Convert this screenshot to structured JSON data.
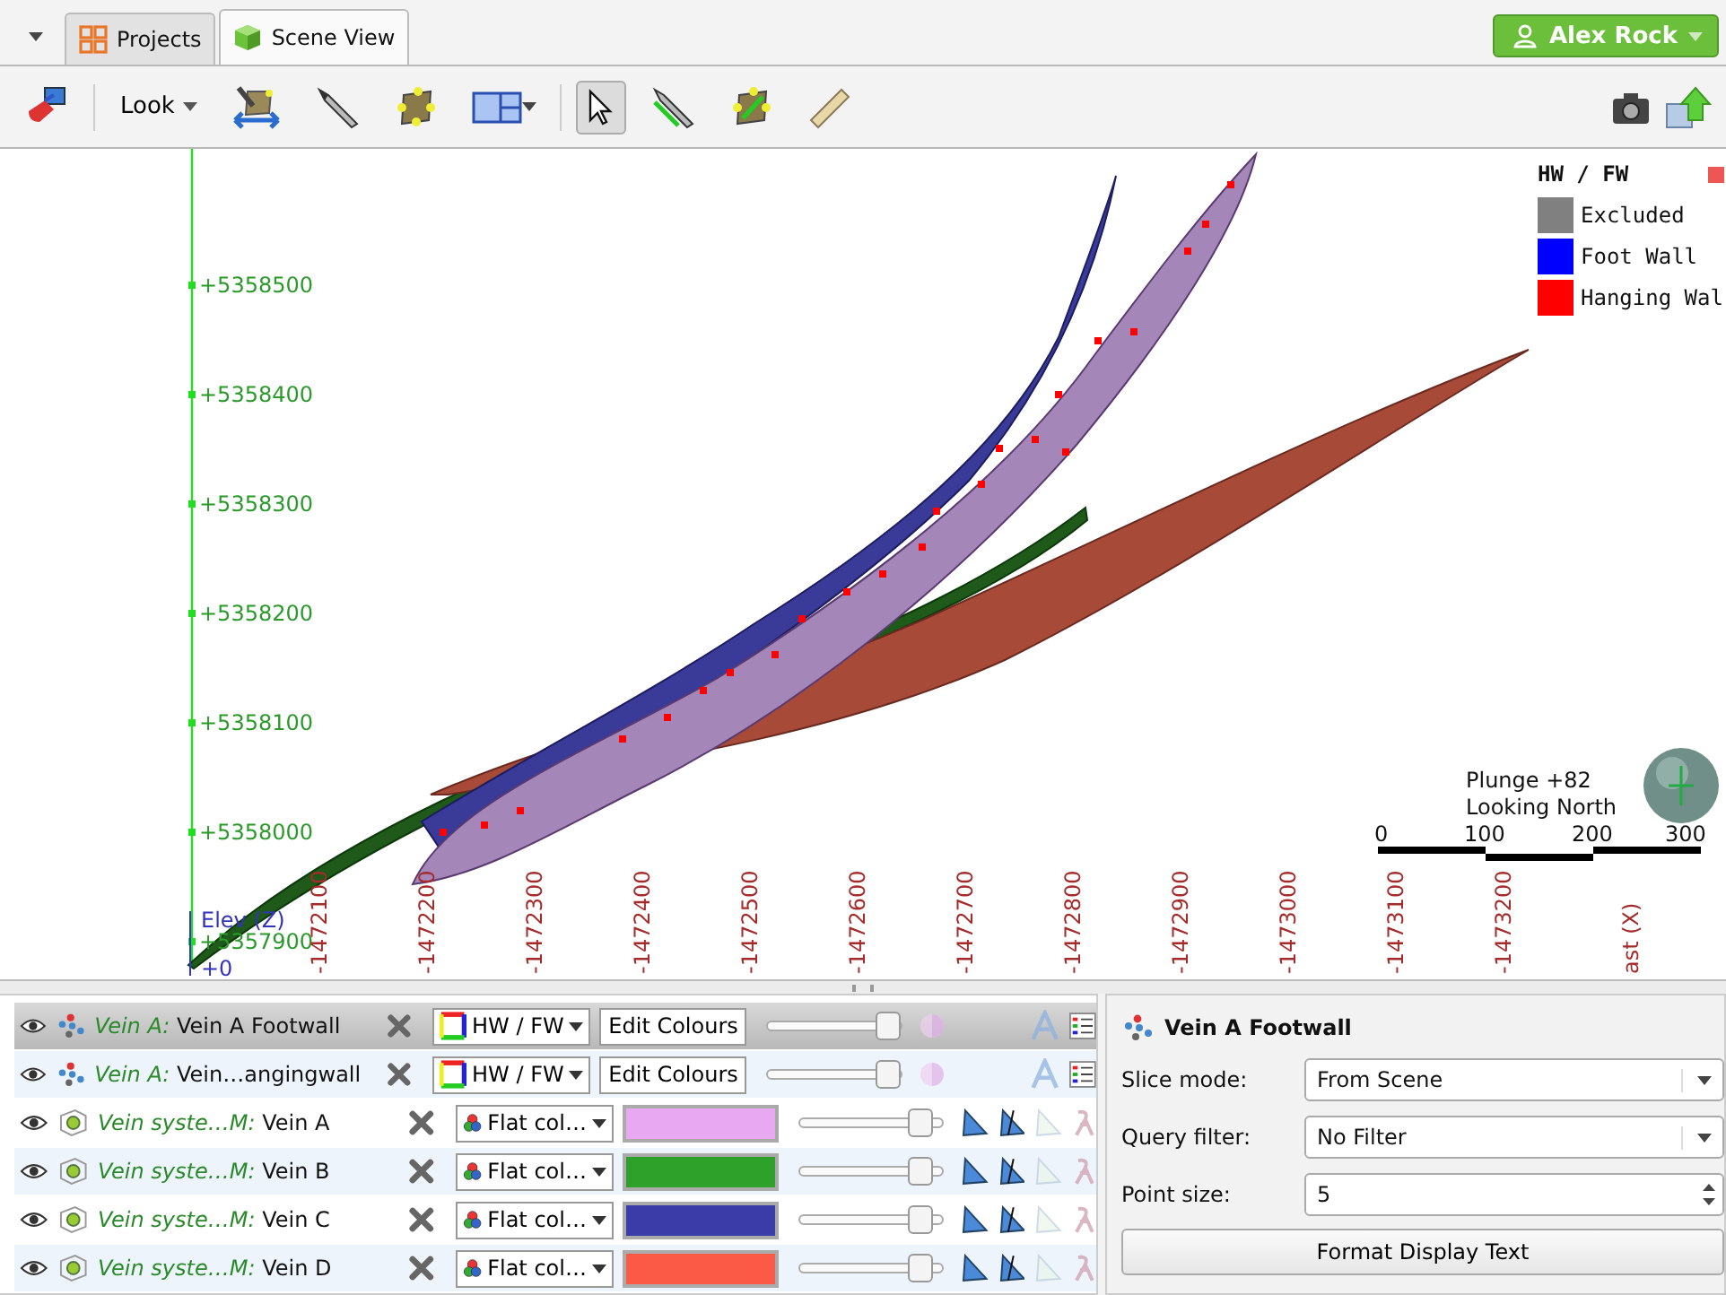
{
  "tabs": [
    {
      "label": "Projects",
      "kind": "grid",
      "selected": false
    },
    {
      "label": "Scene View",
      "kind": "cube",
      "selected": true
    }
  ],
  "user": {
    "name": "Alex Rock"
  },
  "toolbar": {
    "look_label": "Look",
    "tools": [
      {
        "kind": "eraser",
        "pressed": false
      },
      {
        "kind": "move-plane",
        "pressed": false
      },
      {
        "kind": "knife",
        "pressed": false
      },
      {
        "kind": "plane",
        "pressed": false
      },
      {
        "kind": "layout",
        "pressed": false
      },
      {
        "kind": "pointer",
        "pressed": true
      },
      {
        "kind": "knife-line",
        "pressed": false
      },
      {
        "kind": "plane-line",
        "pressed": false
      },
      {
        "kind": "ruler",
        "pressed": false
      }
    ]
  },
  "scene": {
    "y_axis_labels": [
      "+5358500",
      "+5358400",
      "+5358300",
      "+5358200",
      "+5358100",
      "+5358000",
      "+5357900"
    ],
    "x_axis_labels": [
      "-1472100",
      "-1472200",
      "-1472300",
      "-1472400",
      "-1472500",
      "-1472600",
      "-1472700",
      "-1472800",
      "-1472900",
      "-1473000",
      "-1473100",
      "-1473200"
    ],
    "z_axis_title": "Elev (Z)",
    "x_axis_title": "ast (X)",
    "origin_label": "+0",
    "orientation": [
      "Plunge +82",
      "Looking North"
    ],
    "scale_labels": [
      "0",
      "100",
      "200",
      "300"
    ],
    "legend": {
      "title": "HW / FW",
      "items": [
        {
          "label": "Excluded",
          "color": "#808080"
        },
        {
          "label": "Foot Wall",
          "color": "#0000ff"
        },
        {
          "label": "Hanging Wal",
          "color": "#ff0000"
        }
      ]
    }
  },
  "layers": [
    {
      "kind": "points",
      "prefix": "Vein A:",
      "name": "Vein A Footwall",
      "selected": true,
      "mode": "HW / FW",
      "edit": "Edit Colours",
      "level": 0.9
    },
    {
      "kind": "points",
      "prefix": "Vein A:",
      "name": "Vein…angingwall",
      "selected": false,
      "mode": "HW / FW",
      "edit": "Edit Colours",
      "level": 0.9
    },
    {
      "kind": "mesh",
      "prefix": "Vein syste…M:",
      "name": "Vein A",
      "selected": false,
      "mode": "Flat col…",
      "color": "#e8a8f2",
      "level": 0.9
    },
    {
      "kind": "mesh",
      "prefix": "Vein syste…M:",
      "name": "Vein B",
      "selected": false,
      "mode": "Flat col…",
      "color": "#2ea12a",
      "level": 0.9
    },
    {
      "kind": "mesh",
      "prefix": "Vein syste…M:",
      "name": "Vein C",
      "selected": false,
      "mode": "Flat col…",
      "color": "#3c3ca8",
      "level": 0.9
    },
    {
      "kind": "mesh",
      "prefix": "Vein syste…M:",
      "name": "Vein D",
      "selected": false,
      "mode": "Flat col…",
      "color": "#fb5a46",
      "level": 0.9
    }
  ],
  "properties": {
    "title": "Vein A Footwall",
    "fields": [
      {
        "kind": "select",
        "label": "Slice mode:",
        "value": "From Scene"
      },
      {
        "kind": "select",
        "label": "Query filter:",
        "value": "No Filter"
      },
      {
        "kind": "spin",
        "label": "Point size:",
        "value": "5"
      }
    ],
    "button": "Format Display Text"
  }
}
